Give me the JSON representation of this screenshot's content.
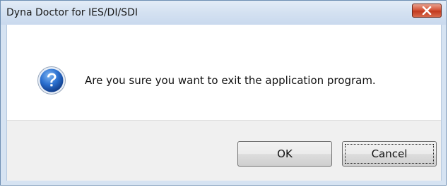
{
  "window": {
    "title": "Dyna Doctor for IES/DI/SDI",
    "close_icon": "close-icon"
  },
  "message": {
    "icon": "question-icon",
    "text": "Are you sure you want to exit the application program."
  },
  "buttons": {
    "ok_label": "OK",
    "cancel_label": "Cancel"
  },
  "colors": {
    "close_button": "#c8402a",
    "icon_blue": "#1d5fb8",
    "button_bar": "#f0f0f0"
  }
}
